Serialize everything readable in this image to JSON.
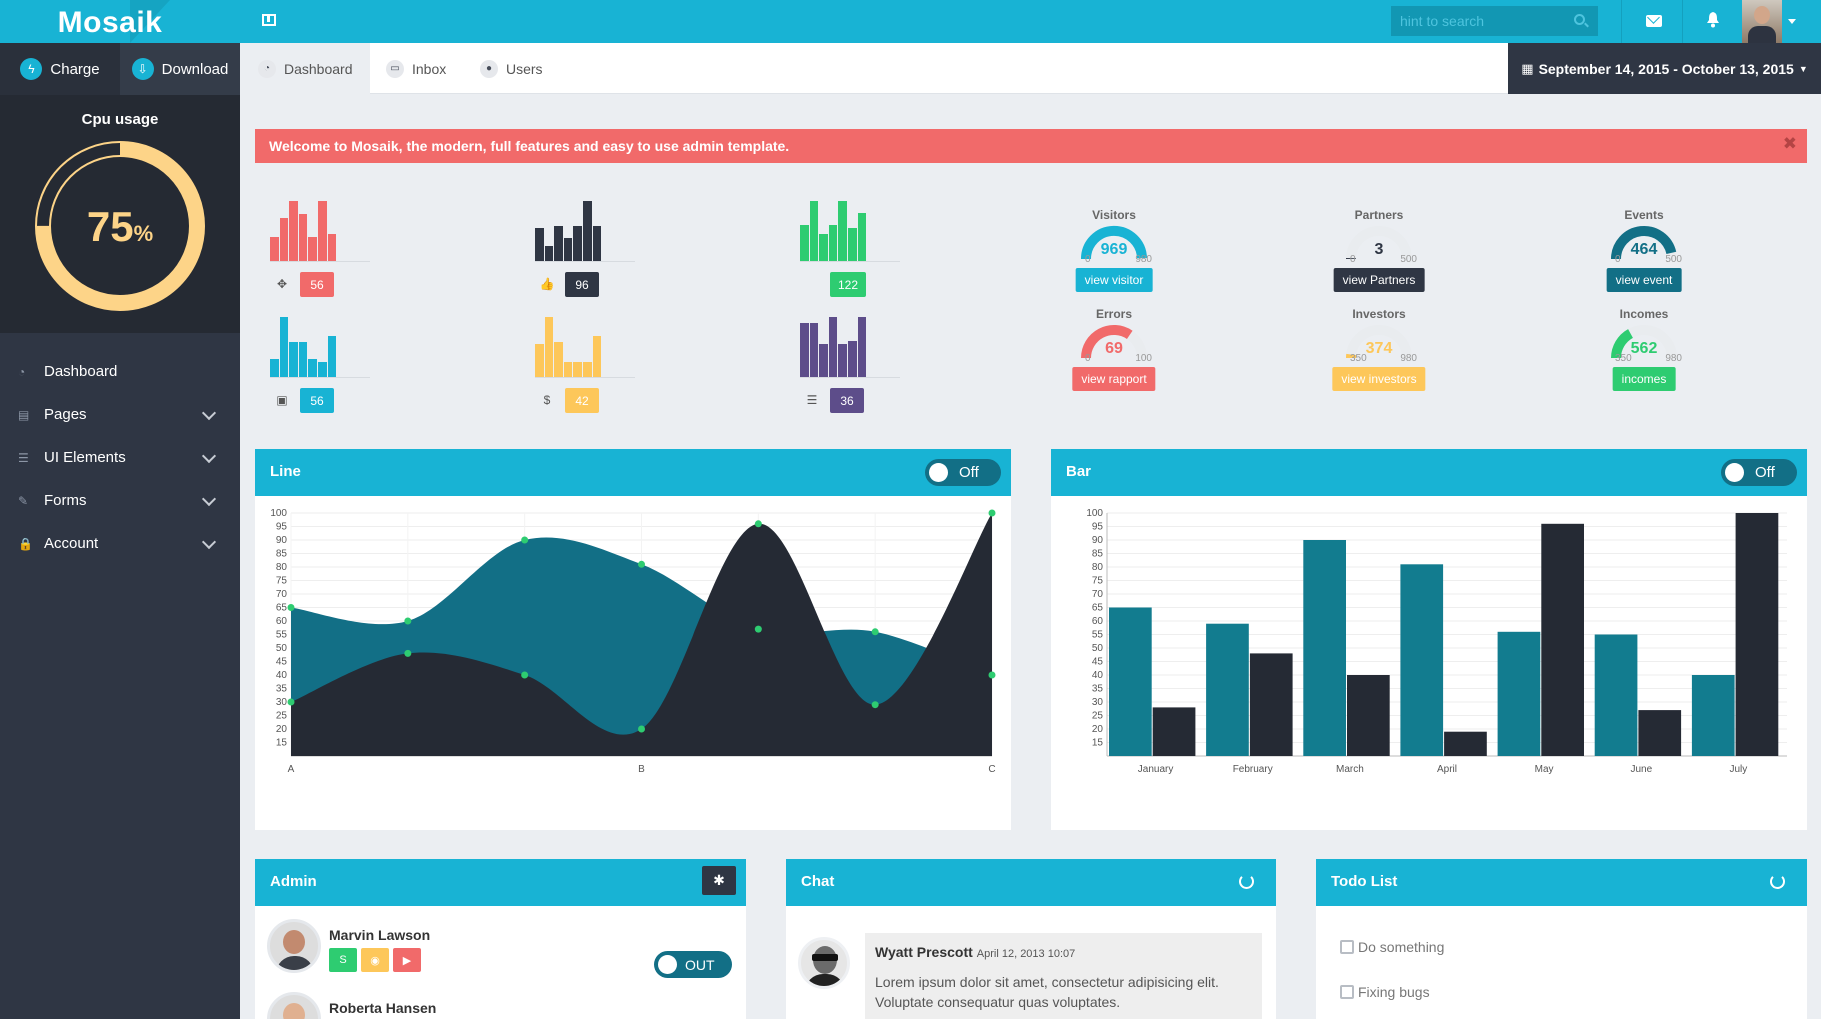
{
  "app": {
    "logo": "Mosaik"
  },
  "sidebar": {
    "charge_label": "Charge",
    "download_label": "Download",
    "cpu": {
      "title": "Cpu usage",
      "value": "75",
      "unit": "%",
      "level": 0.75
    },
    "menu": [
      {
        "label": "Dashboard",
        "icon": "dashboard-icon",
        "expandable": false
      },
      {
        "label": "Pages",
        "icon": "file-icon",
        "expandable": true
      },
      {
        "label": "UI Elements",
        "icon": "list-icon",
        "expandable": true
      },
      {
        "label": "Forms",
        "icon": "edit-icon",
        "expandable": true
      },
      {
        "label": "Account",
        "icon": "lock-icon",
        "expandable": true
      }
    ]
  },
  "topbar": {
    "search_placeholder": "hint to search"
  },
  "tabs": [
    {
      "label": "Dashboard",
      "icon": "dashboard-icon",
      "active": true
    },
    {
      "label": "Inbox",
      "icon": "inbox-icon",
      "active": false
    },
    {
      "label": "Users",
      "icon": "user-icon",
      "active": false
    }
  ],
  "daterange": "September 14, 2015 - October 13, 2015",
  "alert": {
    "text": "Welcome to Mosaik, the modern, full features and easy to use admin template.",
    "close": "✖"
  },
  "stats": [
    {
      "icon": "dropbox-icon",
      "glyph": "✥",
      "value": "56",
      "color": "#f16a6a",
      "bars": [
        0.4,
        0.72,
        1.0,
        0.78,
        0.4,
        1.0,
        0.45
      ]
    },
    {
      "icon": "thumbs-up-icon",
      "glyph": "👍",
      "value": "96",
      "color": "#2f3644",
      "bars": [
        0.55,
        0.25,
        0.58,
        0.38,
        0.58,
        1.0,
        0.58
      ]
    },
    {
      "icon": "apple-icon",
      "glyph": "",
      "value": "122",
      "color": "#2ecc71",
      "bars": [
        0.6,
        1.0,
        0.45,
        0.6,
        1.0,
        0.55,
        0.8
      ]
    },
    {
      "icon": "instagram-icon",
      "glyph": "▣",
      "value": "56",
      "color": "#18b3d4",
      "bars": [
        0.3,
        1.0,
        0.58,
        0.58,
        0.3,
        0.25,
        0.68
      ]
    },
    {
      "icon": "dollar-icon",
      "glyph": "$",
      "value": "42",
      "color": "#fdc75a",
      "bars": [
        0.55,
        1.0,
        0.58,
        0.25,
        0.25,
        0.25,
        0.68
      ]
    },
    {
      "icon": "stack-overflow-icon",
      "glyph": "☰",
      "value": "36",
      "color": "#5d4d8a",
      "bars": [
        0.9,
        0.9,
        0.55,
        1.0,
        0.55,
        0.6,
        1.0
      ]
    }
  ],
  "gauges": [
    {
      "title": "Visitors",
      "value": "969",
      "min": "0",
      "max": "980",
      "fraction": 0.99,
      "color": "#18b3d4",
      "button": "view visitor"
    },
    {
      "title": "Partners",
      "value": "3",
      "min": "0",
      "max": "500",
      "fraction": 0.01,
      "color": "#2f3644",
      "button": "view Partners"
    },
    {
      "title": "Events",
      "value": "464",
      "min": "0",
      "max": "500",
      "fraction": 0.93,
      "color": "#126f86",
      "button": "view event"
    },
    {
      "title": "Errors",
      "value": "69",
      "min": "0",
      "max": "100",
      "fraction": 0.69,
      "color": "#f16a6a",
      "button": "view rapport"
    },
    {
      "title": "Investors",
      "value": "374",
      "min": "350",
      "max": "980",
      "fraction": 0.04,
      "color": "#fdc75a",
      "button": "view investors"
    },
    {
      "title": "Incomes",
      "value": "562",
      "min": "350",
      "max": "980",
      "fraction": 0.34,
      "color": "#2ecc71",
      "button": "incomes"
    }
  ],
  "line_panel": {
    "title": "Line",
    "toggle": "Off"
  },
  "bar_panel": {
    "title": "Bar",
    "toggle": "Off"
  },
  "admin_panel": {
    "title": "Admin",
    "users": [
      {
        "name": "Marvin Lawson",
        "status": "OUT"
      },
      {
        "name": "Roberta Hansen",
        "status": ""
      }
    ]
  },
  "chat_panel": {
    "title": "Chat",
    "messages": [
      {
        "author": "Wyatt Prescott",
        "time": "April 12, 2013 10:07",
        "text": "Lorem ipsum dolor sit amet, consectetur adipisicing elit. Voluptate consequatur quas voluptates."
      }
    ]
  },
  "todo_panel": {
    "title": "Todo List",
    "items": [
      {
        "label": "Do something"
      },
      {
        "label": "Fixing bugs"
      }
    ]
  },
  "chart_data": [
    {
      "type": "area",
      "categories": [
        "A",
        "B",
        "C"
      ],
      "yticks": [
        15,
        20,
        25,
        30,
        35,
        40,
        45,
        50,
        55,
        60,
        65,
        70,
        75,
        80,
        85,
        90,
        95,
        100
      ],
      "ylim": [
        10,
        100
      ],
      "x": [
        0,
        0.5,
        1,
        1.5,
        2,
        2.5,
        3
      ],
      "series": [
        {
          "values": [
            65,
            60,
            90,
            81,
            57,
            56,
            40
          ],
          "color": "#126f86"
        },
        {
          "values": [
            30,
            48,
            40,
            20,
            96,
            29,
            100
          ],
          "color": "#252a34"
        }
      ]
    },
    {
      "type": "bar",
      "categories": [
        "January",
        "February",
        "March",
        "April",
        "May",
        "June",
        "July"
      ],
      "yticks": [
        15,
        20,
        25,
        30,
        35,
        40,
        45,
        50,
        55,
        60,
        65,
        70,
        75,
        80,
        85,
        90,
        95,
        100
      ],
      "ylim": [
        10,
        100
      ],
      "series": [
        {
          "values": [
            65,
            59,
            90,
            81,
            56,
            55,
            40
          ],
          "color": "#127c8f"
        },
        {
          "values": [
            28,
            48,
            40,
            19,
            96,
            27,
            100
          ],
          "color": "#252a34"
        }
      ]
    }
  ]
}
